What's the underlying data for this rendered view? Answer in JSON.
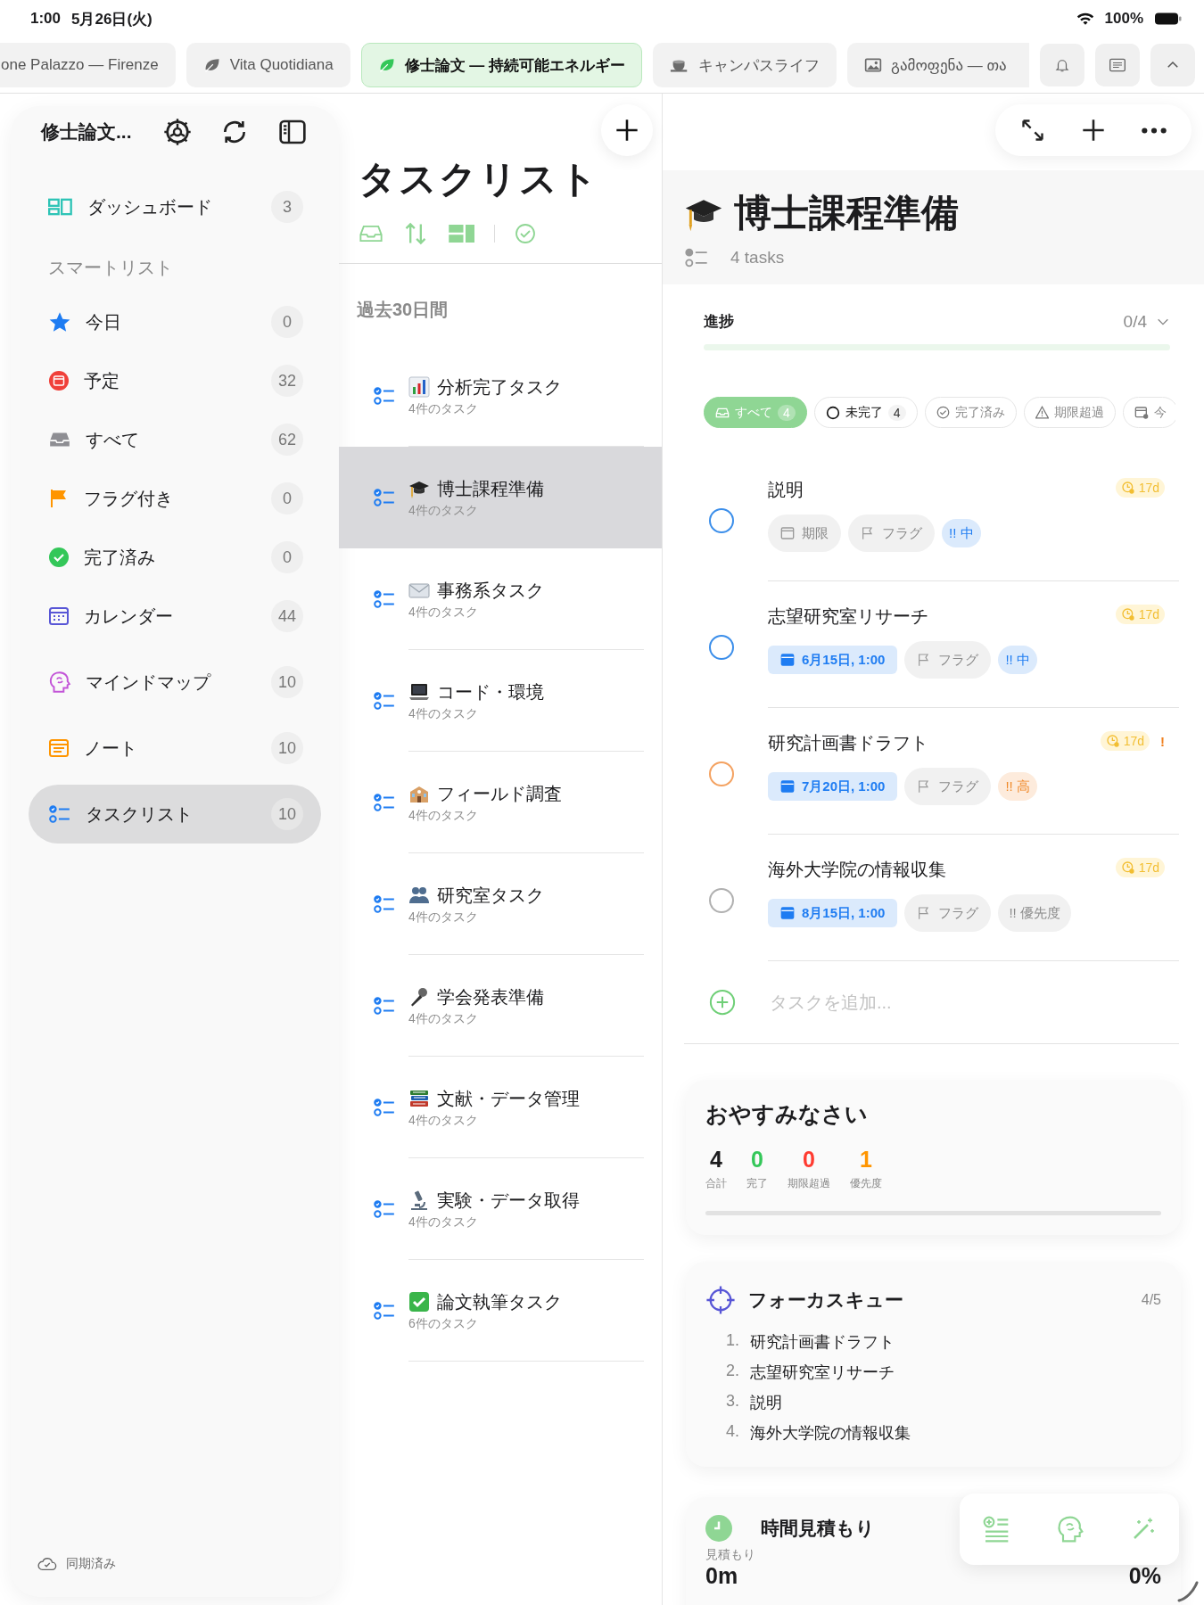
{
  "status_bar": {
    "time": "1:00",
    "date": "5月26日(火)",
    "battery": "100%"
  },
  "tabs": [
    {
      "label": "one Palazzo — Firenze",
      "kind": "plain",
      "selected": false
    },
    {
      "label": "Vita Quotidiana",
      "kind": "leaf",
      "selected": false
    },
    {
      "label": "修士論文 — 持続可能エネルギー",
      "kind": "leaf",
      "selected": true
    },
    {
      "label": "キャンパスライフ",
      "kind": "cup",
      "selected": false
    },
    {
      "label": "გამოფენა — თა",
      "kind": "image",
      "selected": false
    }
  ],
  "sidebar": {
    "title": "修士論文...",
    "dashboard": {
      "kind": "dashboard",
      "label": "ダッシュボード",
      "count": "3",
      "selected": false
    },
    "section_title": "スマートリスト",
    "items": [
      {
        "kind": "star",
        "label": "今日",
        "count": "0",
        "selected": false
      },
      {
        "kind": "scheduled",
        "label": "予定",
        "count": "32",
        "selected": false
      },
      {
        "kind": "tray",
        "label": "すべて",
        "count": "62",
        "selected": false
      },
      {
        "kind": "flag",
        "label": "フラグ付き",
        "count": "0",
        "selected": false
      },
      {
        "kind": "done",
        "label": "完了済み",
        "count": "0",
        "selected": false
      },
      {
        "kind": "calendar",
        "label": "カレンダー",
        "count": "44",
        "selected": false
      },
      {
        "kind": "mindmap",
        "label": "マインドマップ",
        "count": "10",
        "selected": false
      },
      {
        "kind": "notes",
        "label": "ノート",
        "count": "10",
        "selected": false
      },
      {
        "kind": "tasklist",
        "label": "タスクリスト",
        "count": "10",
        "selected": true
      }
    ],
    "sync_status": "同期済み"
  },
  "task_lists": {
    "title": "タスクリスト",
    "group": "過去30日間",
    "items": [
      {
        "kind": "chart",
        "name": "分析完了タスク",
        "subtitle": "4件のタスク",
        "selected": false
      },
      {
        "kind": "cap",
        "name": "博士課程準備",
        "subtitle": "4件のタスク",
        "selected": true
      },
      {
        "kind": "mail",
        "name": "事務系タスク",
        "subtitle": "4件のタスク",
        "selected": false
      },
      {
        "kind": "laptop",
        "name": "コード・環境",
        "subtitle": "4件のタスク",
        "selected": false
      },
      {
        "kind": "school",
        "name": "フィールド調査",
        "subtitle": "4件のタスク",
        "selected": false
      },
      {
        "kind": "people",
        "name": "研究室タスク",
        "subtitle": "4件のタスク",
        "selected": false
      },
      {
        "kind": "mic",
        "name": "学会発表準備",
        "subtitle": "4件のタスク",
        "selected": false
      },
      {
        "kind": "books",
        "name": "文献・データ管理",
        "subtitle": "4件のタスク",
        "selected": false
      },
      {
        "kind": "microscope",
        "name": "実験・データ取得",
        "subtitle": "4件のタスク",
        "selected": false
      },
      {
        "kind": "check",
        "name": "論文執筆タスク",
        "subtitle": "6件のタスク",
        "selected": false
      }
    ]
  },
  "detail": {
    "title": "博士課程準備",
    "task_count": "4 tasks",
    "progress": {
      "label": "進捗",
      "value": "0/4",
      "level": 0
    },
    "filters": [
      {
        "kind": "all",
        "label": "すべて",
        "count": "4",
        "selected": true
      },
      {
        "kind": "open",
        "label": "未完了",
        "count": "4",
        "selected": false
      },
      {
        "kind": "done",
        "label": "完了済み",
        "selected": false
      },
      {
        "kind": "overdue",
        "label": "期限超過",
        "selected": false
      },
      {
        "kind": "today",
        "label": "今",
        "selected": false
      }
    ],
    "tasks": [
      {
        "title": "説明",
        "age": "17d",
        "urgent": false,
        "due": "期限",
        "due_set": false,
        "flag": "フラグ",
        "kind": "medium",
        "priority_label": "!! 中"
      },
      {
        "title": "志望研究室リサーチ",
        "age": "17d",
        "urgent": false,
        "due": "6月15日, 1:00",
        "due_set": true,
        "flag": "フラグ",
        "kind": "medium",
        "priority_label": "!! 中"
      },
      {
        "title": "研究計画書ドラフト",
        "age": "17d",
        "urgent": true,
        "urgent_mark": "!",
        "due": "7月20日, 1:00",
        "due_set": true,
        "flag": "フラグ",
        "kind": "high",
        "priority_label": "!! 高"
      },
      {
        "title": "海外大学院の情報収集",
        "age": "17d",
        "urgent": false,
        "due": "8月15日, 1:00",
        "due_set": true,
        "flag": "フラグ",
        "kind": "none",
        "priority_label": "!! 優先度"
      }
    ],
    "add_placeholder": "タスクを追加..."
  },
  "summary": {
    "greeting": "おやすみなさい",
    "level": 0,
    "stats": [
      {
        "value": "4",
        "label": "合計",
        "color": "#1c1c1e"
      },
      {
        "value": "0",
        "label": "完了",
        "color": "#34c759"
      },
      {
        "value": "0",
        "label": "期限超過",
        "color": "#ff3b30"
      },
      {
        "value": "1",
        "label": "優先度",
        "color": "#ff9500"
      }
    ]
  },
  "focus_queue": {
    "title": "フォーカスキュー",
    "count": "4/5",
    "items": [
      {
        "number": "1.",
        "text": "研究計画書ドラフト"
      },
      {
        "number": "2.",
        "text": "志望研究室リサーチ"
      },
      {
        "number": "3.",
        "text": "説明"
      },
      {
        "number": "4.",
        "text": "海外大学院の情報収集"
      }
    ]
  },
  "time_estimate": {
    "title": "時間見積もり",
    "label": "見積もり",
    "value": "0m",
    "percent": "0%"
  }
}
